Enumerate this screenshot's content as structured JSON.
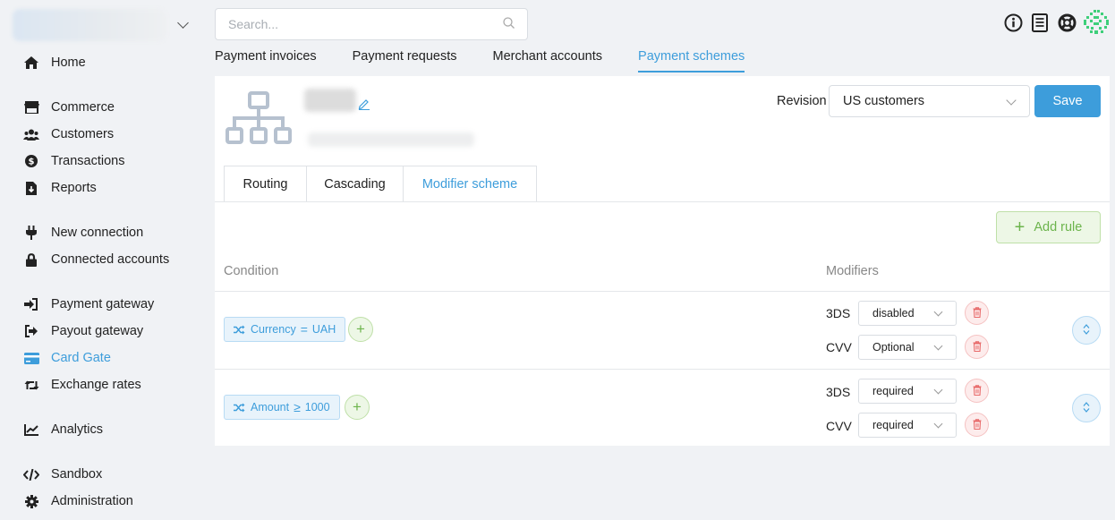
{
  "sidebar": {
    "items": [
      {
        "label": "Home",
        "icon": "home-icon"
      },
      {
        "label": "Commerce",
        "icon": "store-icon"
      },
      {
        "label": "Customers",
        "icon": "users-icon"
      },
      {
        "label": "Transactions",
        "icon": "dollar-icon"
      },
      {
        "label": "Reports",
        "icon": "file-download-icon"
      },
      {
        "label": "New connection",
        "icon": "plug-icon"
      },
      {
        "label": "Connected accounts",
        "icon": "lock-icon"
      },
      {
        "label": "Payment gateway",
        "icon": "sign-in-icon"
      },
      {
        "label": "Payout gateway",
        "icon": "sign-out-icon"
      },
      {
        "label": "Card Gate",
        "icon": "credit-card-icon",
        "active": true
      },
      {
        "label": "Exchange rates",
        "icon": "retweet-icon"
      },
      {
        "label": "Analytics",
        "icon": "chart-line-icon"
      },
      {
        "label": "Sandbox",
        "icon": "code-icon"
      },
      {
        "label": "Administration",
        "icon": "cog-icon"
      }
    ]
  },
  "search": {
    "placeholder": "Search..."
  },
  "main_tabs": [
    {
      "label": "Payment invoices"
    },
    {
      "label": "Payment requests"
    },
    {
      "label": "Merchant accounts"
    },
    {
      "label": "Payment schemes",
      "active": true
    }
  ],
  "scheme": {
    "revision_label": "Revision",
    "revision_value": "US customers",
    "save_label": "Save"
  },
  "sub_tabs": [
    {
      "label": "Routing"
    },
    {
      "label": "Cascading"
    },
    {
      "label": "Modifier scheme",
      "active": true
    }
  ],
  "add_rule_label": "Add rule",
  "table": {
    "headers": {
      "condition": "Condition",
      "modifiers": "Modifiers"
    },
    "rows": [
      {
        "condition": {
          "field": "Currency",
          "operator": "=",
          "value": "UAH"
        },
        "modifiers": [
          {
            "name": "3DS",
            "value": "disabled"
          },
          {
            "name": "CVV",
            "value": "Optional"
          }
        ]
      },
      {
        "condition": {
          "field": "Amount",
          "operator": "≥",
          "value": "1000"
        },
        "modifiers": [
          {
            "name": "3DS",
            "value": "required"
          },
          {
            "name": "CVV",
            "value": "required"
          }
        ]
      }
    ]
  },
  "colors": {
    "accent": "#3d9ddb",
    "success": "#6cb44c",
    "danger": "#e86a6a",
    "background": "#f0f2f5"
  }
}
